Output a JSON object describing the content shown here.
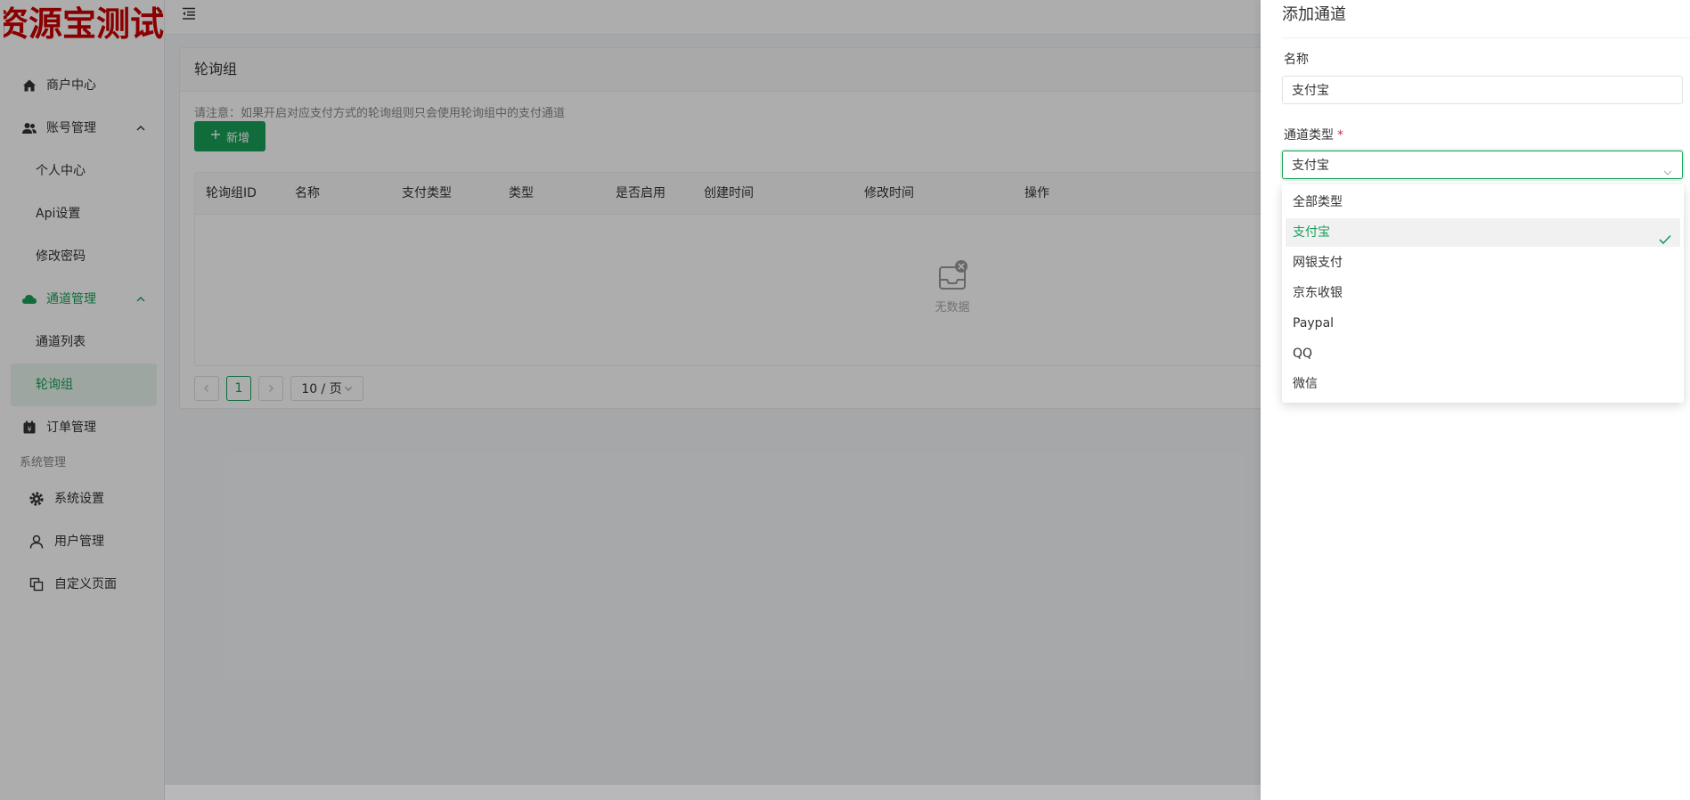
{
  "brand": {
    "logo_text": "资源宝测试",
    "accent": "#18a058"
  },
  "sidebar": {
    "items": [
      {
        "label": "商户中心",
        "icon": "home-icon"
      },
      {
        "label": "账号管理",
        "icon": "users-icon",
        "expanded": true
      },
      {
        "label": "个人中心"
      },
      {
        "label": "Api设置"
      },
      {
        "label": "修改密码"
      },
      {
        "label": "通道管理",
        "icon": "cloud-icon",
        "expanded": true
      },
      {
        "label": "通道列表"
      },
      {
        "label": "轮询组",
        "active": true
      },
      {
        "label": "订单管理",
        "icon": "yen-icon"
      }
    ],
    "group_title": "系统管理",
    "system_items": [
      {
        "label": "系统设置",
        "icon": "gear-icon"
      },
      {
        "label": "用户管理",
        "icon": "user-icon"
      },
      {
        "label": "自定义页面",
        "icon": "pages-icon"
      }
    ]
  },
  "page": {
    "title": "轮询组",
    "notice": "请注意：如果开启对应支付方式的轮询组则只会使用轮询组中的支付通道",
    "add_button": "新增",
    "table": {
      "columns": [
        "轮询组ID",
        "名称",
        "支付类型",
        "类型",
        "是否启用",
        "创建时间",
        "修改时间",
        "操作"
      ],
      "empty_text": "无数据"
    },
    "pagination": {
      "current": "1",
      "page_size": "10 / 页"
    }
  },
  "drawer": {
    "title": "添加通道",
    "name_label": "名称",
    "name_value": "支付宝",
    "type_label": "通道类型",
    "type_value": "支付宝",
    "options": [
      "全部类型",
      "支付宝",
      "网银支付",
      "京东收银",
      "Paypal",
      "QQ",
      "微信"
    ],
    "selected_index": 1
  }
}
